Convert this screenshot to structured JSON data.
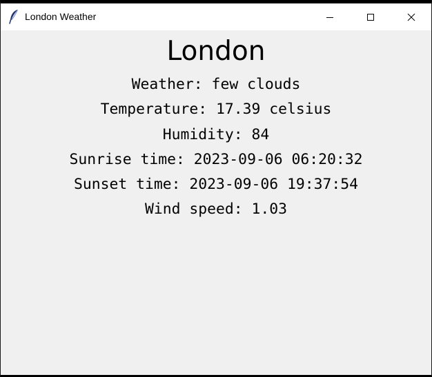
{
  "window": {
    "title": "London Weather",
    "icon": "feather-icon",
    "controls": [
      "minimize-icon",
      "maximize-icon",
      "close-icon"
    ]
  },
  "weather": {
    "city": "London",
    "description_line": "Weather: few clouds",
    "temperature_line": "Temperature: 17.39 celsius",
    "humidity_line": "Humidity: 84",
    "sunrise_line": "Sunrise time: 2023-09-06 06:20:32",
    "sunset_line": "Sunset time: 2023-09-06 19:37:54",
    "wind_line": "Wind speed: 1.03"
  }
}
